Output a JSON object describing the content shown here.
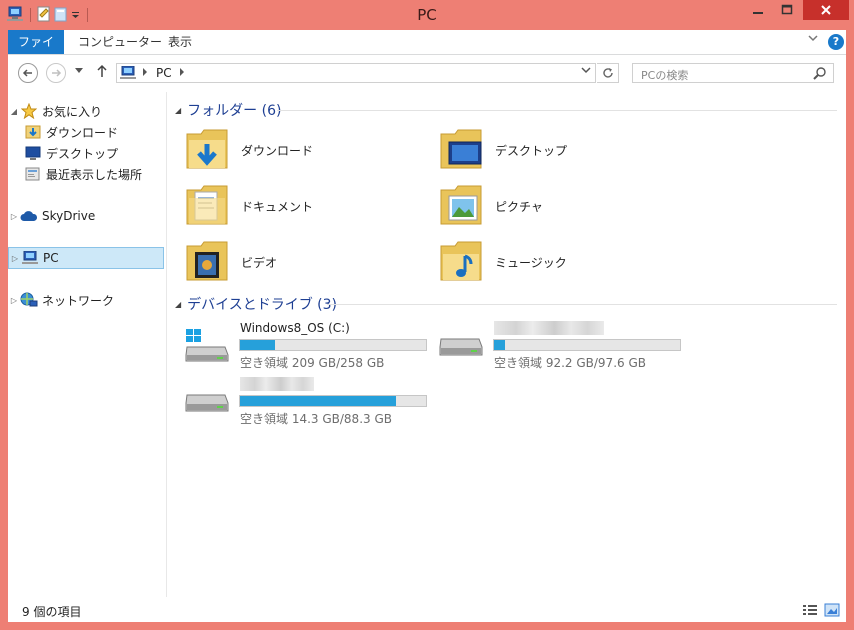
{
  "window": {
    "title": "PC"
  },
  "ribbon": {
    "tabs": [
      "ファイル",
      "コンピューター",
      "表示"
    ]
  },
  "nav": {
    "location": "PC",
    "search_placeholder": "PCの検索"
  },
  "navpane": {
    "favorites": "お気に入り",
    "favorites_items": [
      "ダウンロード",
      "デスクトップ",
      "最近表示した場所"
    ],
    "skydrive": "SkyDrive",
    "pc": "PC",
    "network": "ネットワーク"
  },
  "folders": {
    "group_label": "フォルダー (6)",
    "items": [
      "ダウンロード",
      "デスクトップ",
      "ドキュメント",
      "ピクチャ",
      "ビデオ",
      "ミュージック"
    ]
  },
  "drives": {
    "group_label": "デバイスとドライブ (3)",
    "items": [
      {
        "name": "Windows8_OS (C:)",
        "info": "空き領域 209 GB/258 GB",
        "used_fraction": 0.19
      },
      {
        "name": "",
        "info": "空き領域 92.2 GB/97.6 GB",
        "used_fraction": 0.06
      },
      {
        "name": "",
        "info": "空き領域 14.3 GB/88.3 GB",
        "used_fraction": 0.84
      }
    ]
  },
  "status": {
    "count": "9 個の項目"
  },
  "colors": {
    "frame": "#ee7f74",
    "accent": "#1979ca",
    "bar_fill": "#26a0da",
    "group_text": "#1e3f93"
  }
}
